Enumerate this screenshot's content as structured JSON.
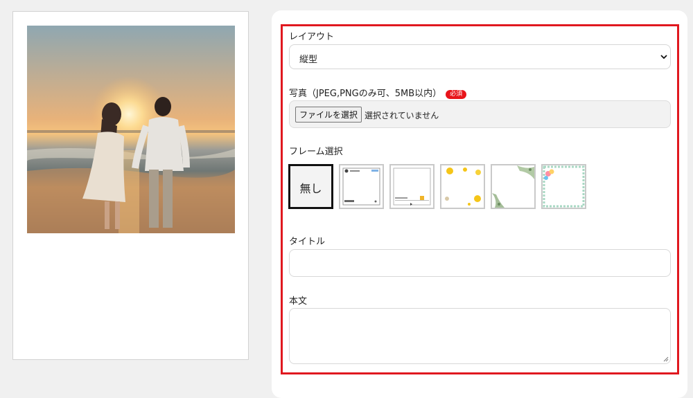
{
  "preview": {
    "photo_icon": "beach-couple-photo"
  },
  "form": {
    "layout": {
      "label": "レイアウト",
      "selected": "縦型"
    },
    "photo": {
      "label": "写真（JPEG,PNGのみ可、5MB以内）",
      "required_badge": "必須",
      "button_label": "ファイルを選択",
      "status": "選択されていません"
    },
    "frame": {
      "label": "フレーム選択",
      "options": [
        {
          "label": "無し",
          "selected": true
        },
        {
          "icon": "social-post-frame",
          "selected": false
        },
        {
          "icon": "music-player-frame",
          "selected": false
        },
        {
          "icon": "yellow-flower-frame",
          "selected": false
        },
        {
          "icon": "leaf-frame",
          "selected": false
        },
        {
          "icon": "balloon-frame",
          "selected": false
        }
      ]
    },
    "title": {
      "label": "タイトル",
      "value": ""
    },
    "body": {
      "label": "本文",
      "value": ""
    }
  },
  "colors": {
    "highlight_border": "#e0181f",
    "required_badge": "#e8141a",
    "selected_frame_border": "#111111"
  }
}
